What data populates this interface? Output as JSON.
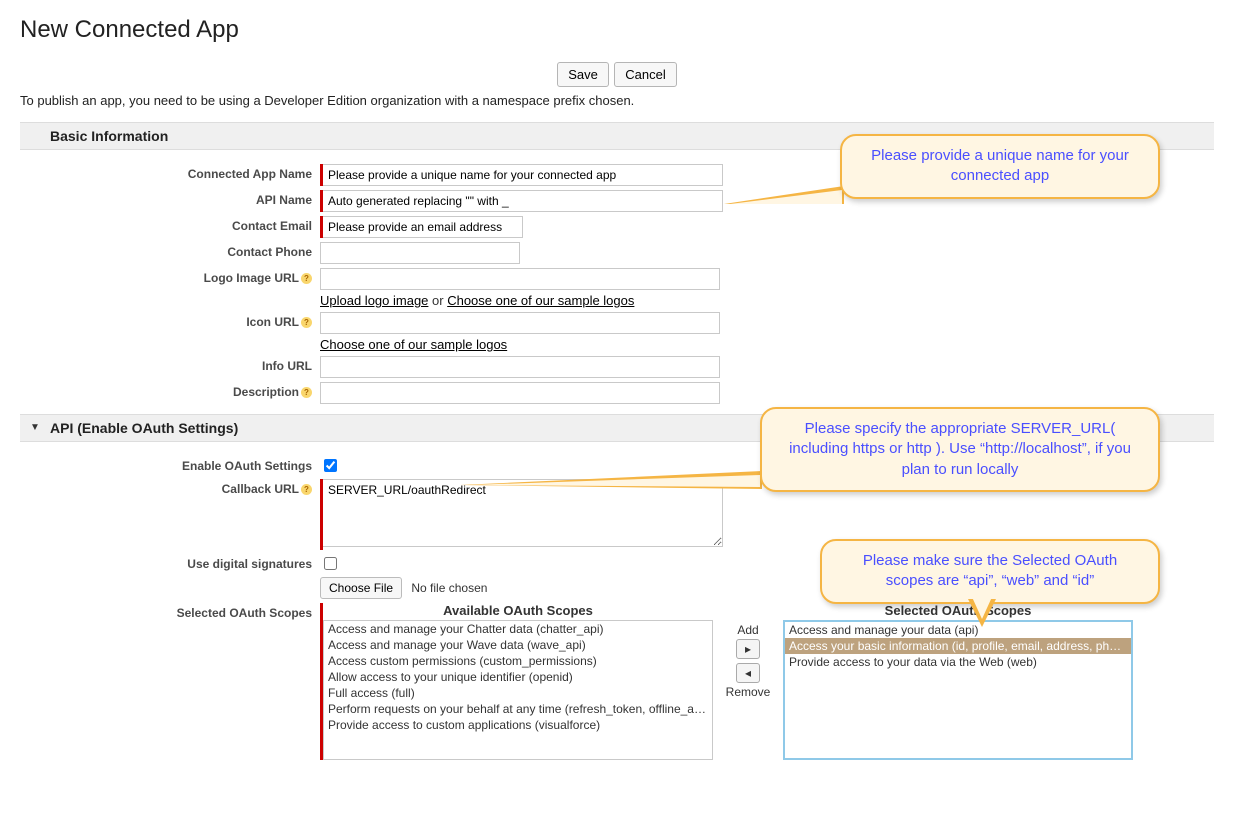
{
  "page": {
    "title": "New Connected App",
    "publish_note": "To publish an app, you need to be using a Developer Edition organization with a namespace prefix chosen."
  },
  "actions": {
    "save": "Save",
    "cancel": "Cancel"
  },
  "sections": {
    "basic": "Basic Information",
    "api": "API (Enable OAuth Settings)"
  },
  "labels": {
    "app_name": "Connected App Name",
    "api_name": "API Name",
    "contact_email": "Contact Email",
    "contact_phone": "Contact Phone",
    "logo_url": "Logo Image URL",
    "icon_url": "Icon URL",
    "info_url": "Info URL",
    "description": "Description",
    "enable_oauth": "Enable OAuth Settings",
    "callback_url": "Callback URL",
    "digital_sig": "Use digital signatures",
    "selected_scopes": "Selected OAuth Scopes"
  },
  "fields": {
    "app_name_value": "Please provide a unique name for your connected app",
    "api_name_value": "Auto generated replacing \"\" with _",
    "contact_email_value": "Please provide an email address",
    "callback_value": "SERVER_URL/oauthRedirect"
  },
  "links": {
    "upload_logo": "Upload logo image",
    "or": " or ",
    "choose_sample": "Choose one of our sample logos"
  },
  "file": {
    "button": "Choose File",
    "status": "No file chosen"
  },
  "scopes": {
    "available_header": "Available OAuth Scopes",
    "selected_header": "Selected OAuth Scopes",
    "add_label": "Add",
    "remove_label": "Remove",
    "available": [
      "Access and manage your Chatter data (chatter_api)",
      "Access and manage your Wave data (wave_api)",
      "Access custom permissions (custom_permissions)",
      "Allow access to your unique identifier (openid)",
      "Full access (full)",
      "Perform requests on your behalf at any time (refresh_token, offline_access)",
      "Provide access to custom applications (visualforce)"
    ],
    "selected": [
      {
        "text": "Access and manage your data (api)",
        "sel": false
      },
      {
        "text": "Access your basic information (id, profile, email, address, phone)",
        "sel": true
      },
      {
        "text": "Provide access to your data via the Web (web)",
        "sel": false
      }
    ]
  },
  "callouts": {
    "c1": "Please provide a unique name for your connected app",
    "c2": "Please specify the appropriate SERVER_URL( including https or http ). Use “http://localhost”, if you plan to run locally",
    "c3": "Please make sure the Selected OAuth scopes are “api”, “web” and “id”"
  }
}
